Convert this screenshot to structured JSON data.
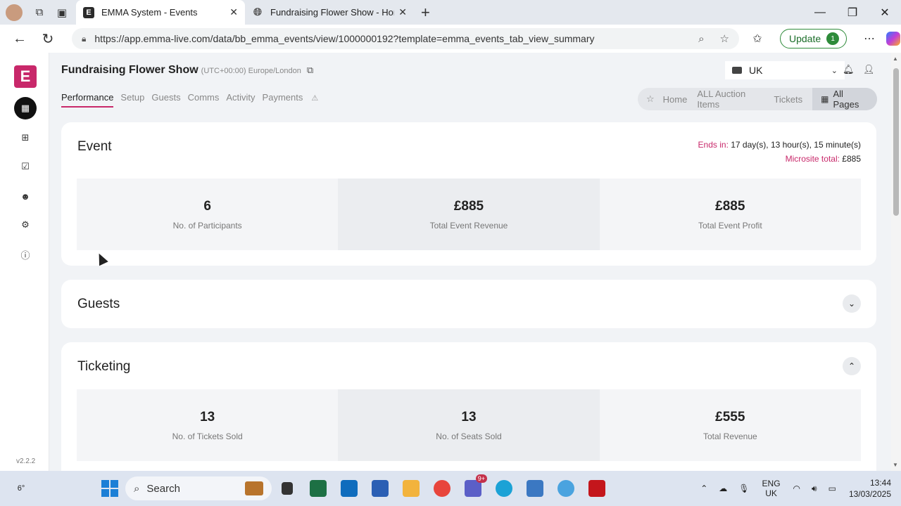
{
  "browser": {
    "tabs": [
      {
        "favicon": "E",
        "title": "EMMA System - Events",
        "active": true
      },
      {
        "favicon": "globe-icon",
        "title": "Fundraising Flower Show - Home",
        "active": false
      }
    ],
    "url": "https://app.emma-live.com/data/bb_emma_events/view/1000000192?template=emma_events_tab_view_summary",
    "update_label": "Update",
    "update_badge": "1"
  },
  "sidebar": {
    "logo": "E",
    "items": [
      {
        "icon": "calendar-icon",
        "active": true
      },
      {
        "icon": "gift-icon",
        "active": false
      },
      {
        "icon": "checklist-icon",
        "active": false
      },
      {
        "icon": "people-icon",
        "active": false
      },
      {
        "icon": "gear-icon",
        "active": false
      },
      {
        "icon": "help-icon",
        "active": false
      }
    ],
    "version": "v2.2.2"
  },
  "header": {
    "event_name": "Fundraising Flower Show",
    "timezone": "(UTC+00:00) Europe/London",
    "region": "UK"
  },
  "tabs": [
    {
      "label": "Performance",
      "active": true
    },
    {
      "label": "Setup",
      "active": false
    },
    {
      "label": "Guests",
      "active": false
    },
    {
      "label": "Comms",
      "active": false
    },
    {
      "label": "Activity",
      "active": false
    },
    {
      "label": "Payments",
      "active": false,
      "warning": true
    }
  ],
  "quicklinks": {
    "items": [
      "Home",
      "ALL Auction Items",
      "Tickets"
    ],
    "all_pages": "All Pages"
  },
  "event_card": {
    "title": "Event",
    "ends_label": "Ends in:",
    "ends_value": "17 day(s), 13 hour(s), 15 minute(s)",
    "microsite_label": "Microsite total:",
    "microsite_value": "£885",
    "stats": [
      {
        "value": "6",
        "label": "No. of Participants"
      },
      {
        "value": "£885",
        "label": "Total Event Revenue"
      },
      {
        "value": "£885",
        "label": "Total Event Profit"
      }
    ]
  },
  "guests_card": {
    "title": "Guests"
  },
  "ticketing_card": {
    "title": "Ticketing",
    "toggle_on": true,
    "stats": [
      {
        "value": "13",
        "label": "No. of Tickets Sold"
      },
      {
        "value": "13",
        "label": "No. of Seats Sold"
      },
      {
        "value": "£555",
        "label": "Total Revenue"
      }
    ]
  },
  "taskbar": {
    "weather": "6°",
    "search_label": "Search",
    "teams_badge": "9+",
    "lang_top": "ENG",
    "lang_bottom": "UK",
    "time": "13:44",
    "date": "13/03/2025"
  },
  "colors": {
    "brand": "#c8286a",
    "accent_green": "#2e8b3a"
  }
}
